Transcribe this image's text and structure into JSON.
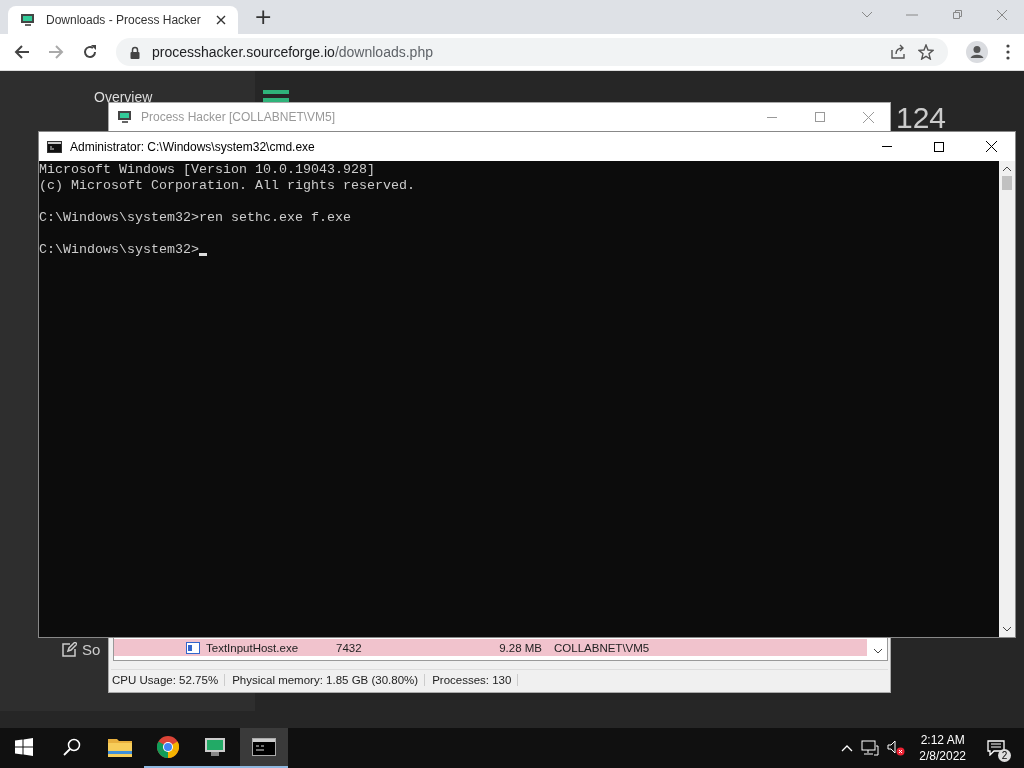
{
  "browser": {
    "tab": {
      "title": "Downloads - Process Hacker",
      "selected": true
    },
    "new_tab": "+",
    "address": {
      "domain": "processhacker.sourceforge.io",
      "path": "/downloads.php"
    }
  },
  "web_page": {
    "nav_item": "Overview",
    "heading": "124",
    "side_link": "So"
  },
  "process_hacker": {
    "title": "Process Hacker [COLLABNET\\VM5]",
    "rows": [
      {
        "name": "TextInputHost.exe",
        "pid": "7432",
        "memory": "9.28 MB",
        "user": "COLLABNET\\VM5",
        "color": "#f1c3cd"
      }
    ],
    "status_bar": [
      "CPU Usage: 52.75%",
      "Physical memory: 1.85 GB (30.80%)",
      "Processes: 130"
    ]
  },
  "cmd": {
    "title": "Administrator: C:\\Windows\\system32\\cmd.exe",
    "paragraphs": [
      [
        "Microsoft Windows [Version 10.0.19043.928]",
        "(c) Microsoft Corporation. All rights reserved."
      ],
      [
        "C:\\Windows\\system32>ren sethc.exe f.exe"
      ],
      [
        "C:\\Windows\\system32>"
      ]
    ],
    "cursor": true
  },
  "taskbar": {
    "items": [
      {
        "kind": "start",
        "running": false,
        "selected": false
      },
      {
        "kind": "search",
        "running": false,
        "selected": false
      },
      {
        "kind": "explorer",
        "running": false,
        "selected": false
      },
      {
        "kind": "chrome",
        "running": true,
        "selected": false
      },
      {
        "kind": "processhacker",
        "running": true,
        "selected": false
      },
      {
        "kind": "cmd",
        "running": true,
        "selected": true
      }
    ],
    "time": "2:12 AM",
    "date": "2/8/2022",
    "notifications": "2"
  }
}
